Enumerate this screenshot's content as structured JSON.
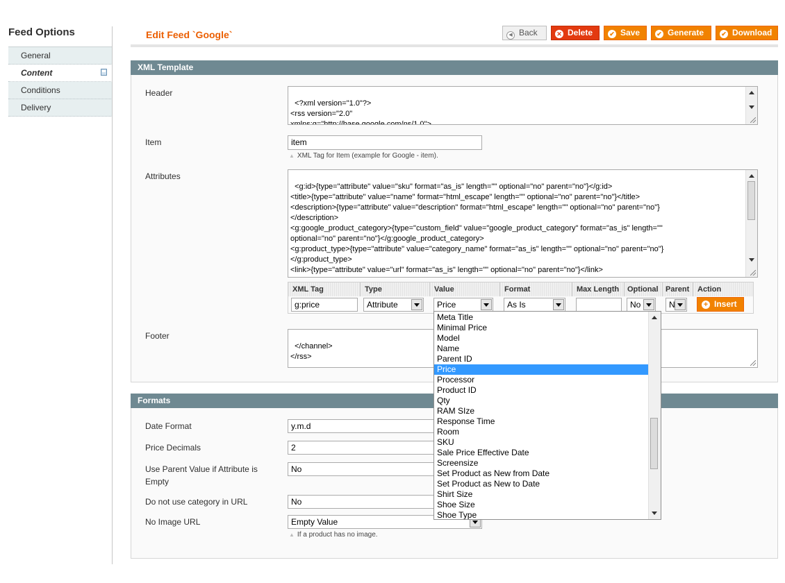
{
  "sidebar": {
    "title": "Feed Options",
    "items": [
      {
        "label": "General"
      },
      {
        "label": "Content"
      },
      {
        "label": "Conditions"
      },
      {
        "label": "Delivery"
      }
    ]
  },
  "header": {
    "title": "Edit Feed `Google`",
    "buttons": {
      "back": "Back",
      "delete": "Delete",
      "save": "Save",
      "generate": "Generate",
      "download": "Download"
    }
  },
  "xml_template": {
    "section_title": "XML Template",
    "header_label": "Header",
    "header_value": "<?xml version=\"1.0\"?>\n<rss version=\"2.0\"\nxmlns:g=\"http://base.google.com/ns/1.0\">\n<channel>",
    "item_label": "Item",
    "item_value": "item",
    "item_note": "XML Tag for Item (example for Google - item).",
    "attributes_label": "Attributes",
    "attributes_value": "<g:id>{type=\"attribute\" value=\"sku\" format=\"as_is\" length=\"\" optional=\"no\" parent=\"no\"}</g:id>\n<title>{type=\"attribute\" value=\"name\" format=\"html_escape\" length=\"\" optional=\"no\" parent=\"no\"}</title>\n<description>{type=\"attribute\" value=\"description\" format=\"html_escape\" length=\"\" optional=\"no\" parent=\"no\"}\n</description>\n<g:google_product_category>{type=\"custom_field\" value=\"google_product_category\" format=\"as_is\" length=\"\"\noptional=\"no\" parent=\"no\"}</g:google_product_category>\n<g:product_type>{type=\"attribute\" value=\"category_name\" format=\"as_is\" length=\"\" optional=\"no\" parent=\"no\"}\n</g:product_type>\n<link>{type=\"attribute\" value=\"url\" format=\"as_is\" length=\"\" optional=\"no\" parent=\"no\"}</link>\n<g:image_link>{type=\"attribute\" value=\"image\" format=\"as_is\" length=\"\" optional=\"no\" parent=\"no\"}</g:image_link>",
    "columns": {
      "xml_tag": "XML Tag",
      "type": "Type",
      "value": "Value",
      "format": "Format",
      "max_length": "Max Length",
      "optional": "Optional",
      "parent": "Parent",
      "action": "Action"
    },
    "row": {
      "xml_tag": "g:price",
      "type": "Attribute",
      "value": "Price",
      "format": "As Is",
      "max_length": "",
      "optional": "No",
      "parent": "N"
    },
    "insert_label": "Insert",
    "footer_label": "Footer",
    "footer_value": "</channel>\n</rss>"
  },
  "value_dropdown": {
    "options": [
      "Meta Title",
      "Minimal Price",
      "Model",
      "Name",
      "Parent ID",
      "Price",
      "Processor",
      "Product ID",
      "Qty",
      "RAM SIze",
      "Response Time",
      "Room",
      "SKU",
      "Sale Price Effective Date",
      "Screensize",
      "Set Product as New from Date",
      "Set Product as New to Date",
      "Shirt Size",
      "Shoe Size",
      "Shoe Type"
    ],
    "selected": "Price"
  },
  "formats": {
    "section_title": "Formats",
    "date_format_label": "Date Format",
    "date_format_value": "y.m.d",
    "price_decimals_label": "Price Decimals",
    "price_decimals_value": "2",
    "use_parent_label": "Use Parent Value if Attribute is Empty",
    "use_parent_value": "No",
    "no_category_url_label": "Do not use category in URL",
    "no_category_url_value": "No",
    "no_image_url_label": "No Image URL",
    "no_image_url_value": "Empty Value",
    "no_image_note": "If a product has no image."
  },
  "colors": {
    "accent": "#f18200",
    "title": "#eb5e00",
    "section_header": "#6f8992",
    "selection": "#3399ff"
  }
}
